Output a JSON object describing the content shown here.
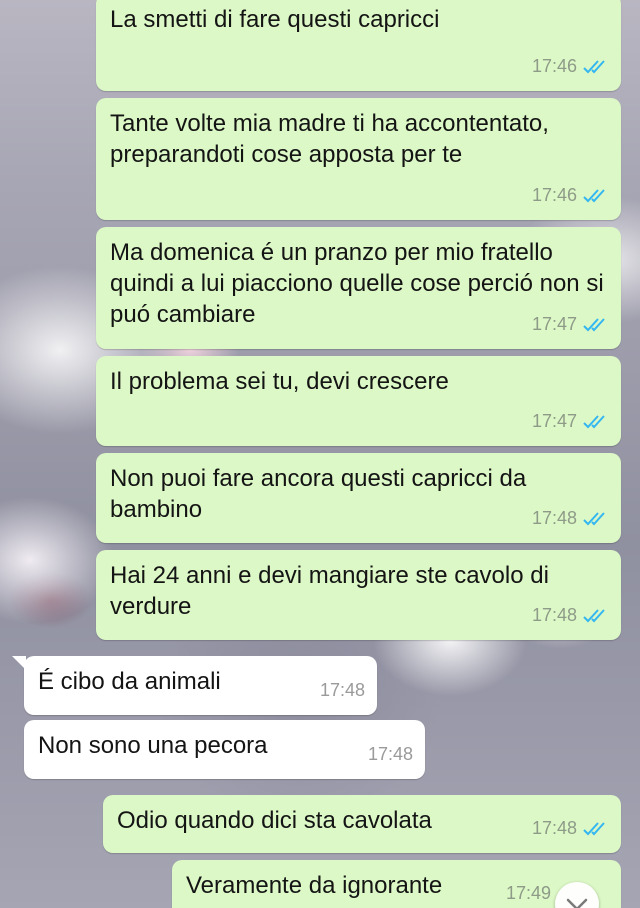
{
  "messages": [
    {
      "direction": "outgoing",
      "text": "La smetti di fare questi capricci",
      "time": "17:46",
      "status": "read"
    },
    {
      "direction": "outgoing",
      "text": "Tante volte mia madre ti ha accontentato, preparandoti cose apposta per te",
      "time": "17:46",
      "status": "read"
    },
    {
      "direction": "outgoing",
      "text": "Ma domenica é un pranzo per mio fratello quindi a lui piacciono quelle cose perció non si puó cambiare",
      "time": "17:47",
      "status": "read"
    },
    {
      "direction": "outgoing",
      "text": "Il problema sei tu, devi crescere",
      "time": "17:47",
      "status": "read"
    },
    {
      "direction": "outgoing",
      "text": "Non puoi fare ancora questi capricci da bambino",
      "time": "17:48",
      "status": "read"
    },
    {
      "direction": "outgoing",
      "text": "Hai 24 anni e devi mangiare ste cavolo di verdure",
      "time": "17:48",
      "status": "read"
    },
    {
      "direction": "incoming",
      "text": "É cibo da animali",
      "time": "17:48"
    },
    {
      "direction": "incoming",
      "text": "Non sono una pecora",
      "time": "17:48"
    },
    {
      "direction": "outgoing",
      "text": "Odio quando dici sta cavolata",
      "time": "17:48",
      "status": "read"
    },
    {
      "direction": "outgoing",
      "text": "Veramente da ignorante",
      "time": "17:49",
      "status": "read"
    }
  ],
  "icons": {
    "read_receipt": "double-check-icon",
    "read_color": "#34b7f1",
    "scroll_down": "chevron-down-icon"
  },
  "colors": {
    "outgoing_bubble": "#dcf8c6",
    "incoming_bubble": "#ffffff"
  }
}
